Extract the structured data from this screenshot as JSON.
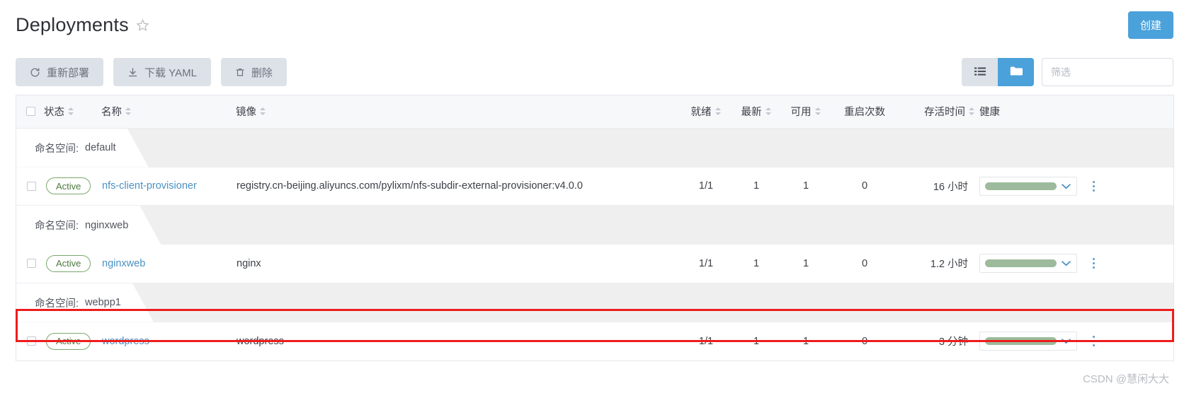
{
  "header": {
    "title": "Deployments",
    "star_icon": "star-outline-icon",
    "create_button": "创建"
  },
  "toolbar": {
    "buttons": [
      {
        "label": "重新部署",
        "icon": "refresh-icon"
      },
      {
        "label": "下载 YAML",
        "icon": "download-icon"
      },
      {
        "label": "删除",
        "icon": "trash-icon"
      }
    ],
    "view_toggle": [
      {
        "icon": "list-view-icon",
        "active": false
      },
      {
        "icon": "folder-group-view-icon",
        "active": true
      }
    ],
    "filter": {
      "placeholder": "筛选",
      "value": ""
    }
  },
  "table": {
    "columns": [
      {
        "label": "状态",
        "sortable": true
      },
      {
        "label": "名称",
        "sortable": true
      },
      {
        "label": "镜像",
        "sortable": true
      },
      {
        "label": "就绪",
        "sortable": true
      },
      {
        "label": "最新",
        "sortable": true
      },
      {
        "label": "可用",
        "sortable": true
      },
      {
        "label": "重启次数",
        "sortable": false
      },
      {
        "label": "存活时间",
        "sortable": true
      },
      {
        "label": "健康",
        "sortable": false
      }
    ],
    "namespace_prefix": "命名空间:",
    "groups": [
      {
        "namespace": "default",
        "rows": [
          {
            "status": "Active",
            "name": "nfs-client-provisioner",
            "image": "registry.cn-beijing.aliyuncs.com/pylixm/nfs-subdir-external-provisioner:v4.0.0",
            "ready": "1/1",
            "up_to_date": "1",
            "available": "1",
            "restarts": "0",
            "age": "16 小时",
            "health_percent": 100,
            "highlighted": false
          }
        ]
      },
      {
        "namespace": "nginxweb",
        "rows": [
          {
            "status": "Active",
            "name": "nginxweb",
            "image": "nginx",
            "ready": "1/1",
            "up_to_date": "1",
            "available": "1",
            "restarts": "0",
            "age": "1.2 小时",
            "health_percent": 100,
            "highlighted": false
          }
        ]
      },
      {
        "namespace": "webpp1",
        "rows": [
          {
            "status": "Active",
            "name": "wordpress",
            "image": "wordpress",
            "ready": "1/1",
            "up_to_date": "1",
            "available": "1",
            "restarts": "0",
            "age": "3 分钟",
            "health_percent": 100,
            "highlighted": true
          }
        ]
      }
    ]
  },
  "watermark": "CSDN @慧闲大大",
  "colors": {
    "accent": "#4ba1da",
    "health_green": "#9dbb9c",
    "status_green": "#4e7a42",
    "link_blue": "#4a90c2",
    "annotation_red": "#ee1c1c"
  }
}
